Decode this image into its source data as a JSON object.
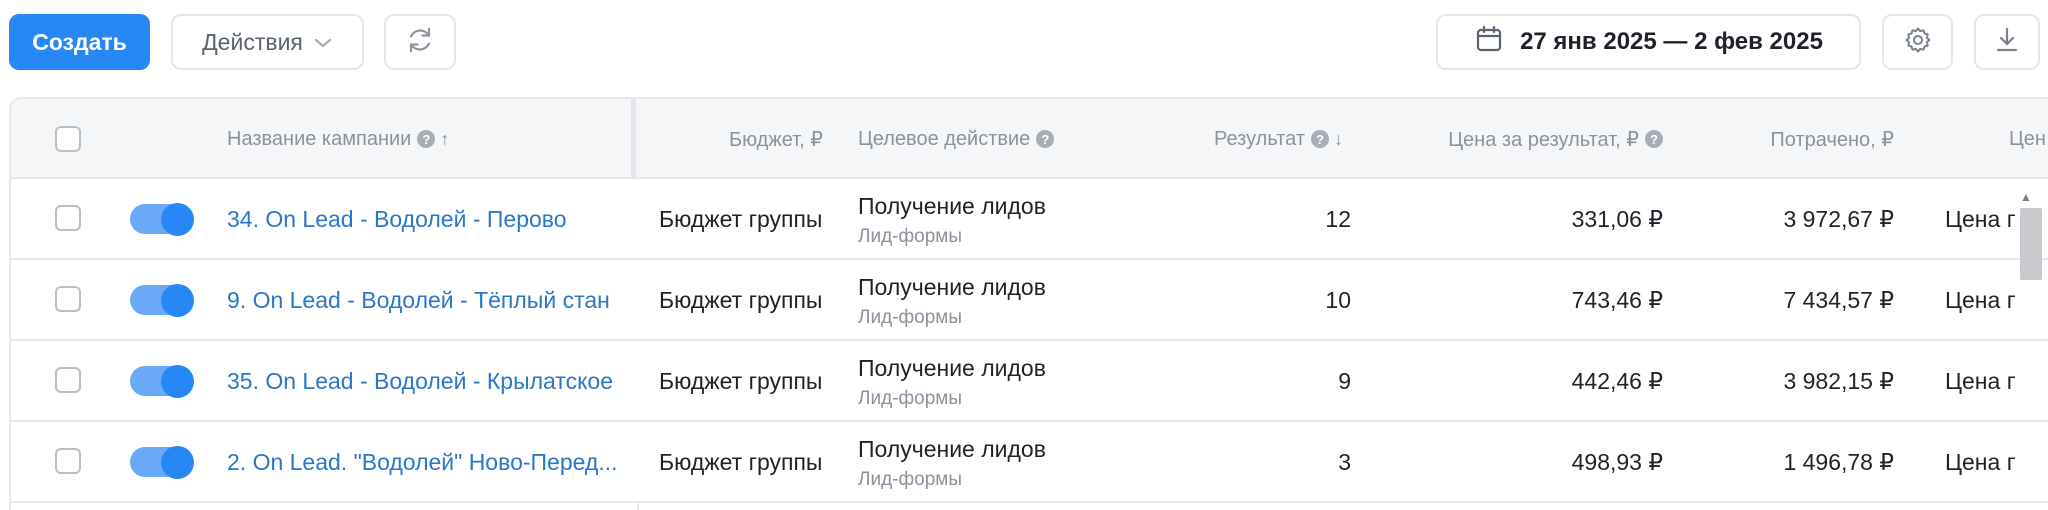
{
  "toolbar": {
    "create_label": "Создать",
    "actions_label": "Действия",
    "date_range": "27 янв 2025 — 2 фев 2025",
    "icons": {
      "actions_chevron": "chevron-down-icon",
      "refresh": "refresh-icon",
      "calendar": "calendar-icon",
      "settings": "gear-icon",
      "download": "download-icon"
    }
  },
  "colors": {
    "accent": "#2787f5",
    "link": "#2a77c9",
    "toggle_track": "#6aa9f7",
    "header_bg": "#f5f6f8",
    "border": "#e5e8ec",
    "muted_text": "#8a929e"
  },
  "table": {
    "headers": {
      "name": "Название кампании",
      "budget": "Бюджет, ₽",
      "goal": "Целевое действие",
      "result": "Результат",
      "cost_per_result": "Цена за результат, ₽",
      "spent": "Потрачено, ₽",
      "cut": "Цен"
    },
    "rows": [
      {
        "name": "34. On Lead - Водолей - Перово",
        "budget": "Бюджет группы",
        "goal": "Получение лидов",
        "goal_sub": "Лид-формы",
        "result": "12",
        "cost_per_result": "331,06 ₽",
        "spent": "3 972,67 ₽",
        "cut": "Цена п"
      },
      {
        "name": "9. On Lead - Водолей - Тёплый стан",
        "budget": "Бюджет группы",
        "goal": "Получение лидов",
        "goal_sub": "Лид-формы",
        "result": "10",
        "cost_per_result": "743,46 ₽",
        "spent": "7 434,57 ₽",
        "cut": "Цена п"
      },
      {
        "name": "35. On Lead - Водолей - Крылатское",
        "budget": "Бюджет группы",
        "goal": "Получение лидов",
        "goal_sub": "Лид-формы",
        "result": "9",
        "cost_per_result": "442,46 ₽",
        "spent": "3 982,15 ₽",
        "cut": "Цена п"
      },
      {
        "name": "2. On Lead. \"Водолей\" Ново-Перед...",
        "budget": "Бюджет группы",
        "goal": "Получение лидов",
        "goal_sub": "Лид-формы",
        "result": "3",
        "cost_per_result": "498,93 ₽",
        "spent": "1 496,78 ₽",
        "cut": "Цена п"
      }
    ]
  }
}
